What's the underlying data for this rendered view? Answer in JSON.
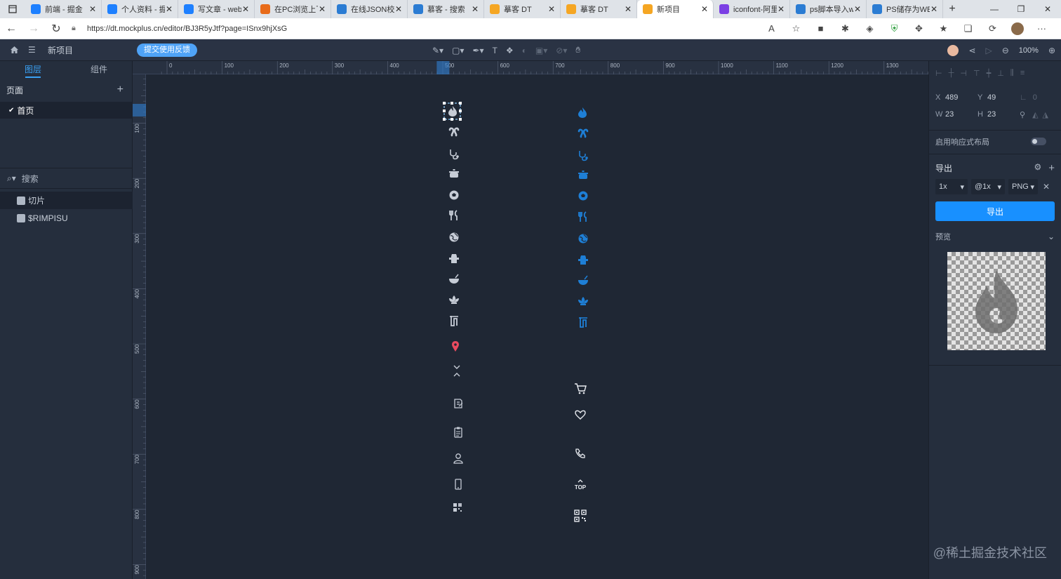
{
  "tabs": [
    {
      "title": "前端 - 掘金",
      "favcolor": "#1e80ff"
    },
    {
      "title": "个人资料 - 掘",
      "favcolor": "#1e80ff"
    },
    {
      "title": "写文章 - web",
      "favcolor": "#1e80ff"
    },
    {
      "title": "在PC浏览上下",
      "favcolor": "#e86b1a"
    },
    {
      "title": "在线JSON校验",
      "favcolor": "#2b7cd3"
    },
    {
      "title": "慕客 - 搜索",
      "favcolor": "#2b7cd3"
    },
    {
      "title": "摹客 DT",
      "favcolor": "#f5a623"
    },
    {
      "title": "摹客 DT",
      "favcolor": "#f5a623"
    },
    {
      "title": "新项目",
      "favcolor": "#f5a623",
      "active": true
    },
    {
      "title": "iconfont-阿里",
      "favcolor": "#7b3fe4"
    },
    {
      "title": "ps脚本导入w",
      "favcolor": "#2b7cd3"
    },
    {
      "title": "PS储存为WEB",
      "favcolor": "#2b7cd3"
    }
  ],
  "url": "https://dt.mockplus.cn/editor/BJ3R5yJtf?page=ISnx9hjXsG",
  "toolbar": {
    "project_name": "新项目",
    "feedback_label": "提交使用反馈",
    "zoom": "100%"
  },
  "left": {
    "tab_layers": "图层",
    "tab_components": "组件",
    "pages_header": "页面",
    "pages": [
      "首页"
    ],
    "search_placeholder": "搜索",
    "layers": [
      "切片",
      "$RIMPISU"
    ]
  },
  "ruler": {
    "h_labels": [
      "0",
      "100",
      "200",
      "300",
      "400",
      "500",
      "600",
      "700",
      "800",
      "900",
      "1000",
      "1100",
      "1200",
      "1300"
    ],
    "v_labels": [
      "100",
      "200",
      "300",
      "400",
      "500",
      "600",
      "700",
      "800",
      "900"
    ]
  },
  "right": {
    "x_label": "X",
    "x_value": "489",
    "y_label": "Y",
    "y_value": "49",
    "w_label": "W",
    "w_value": "23",
    "h_label": "H",
    "h_value": "23",
    "rot_value": "0",
    "responsive_label": "启用响应式布局",
    "export_header": "导出",
    "export_scale": "1x",
    "export_suffix": "@1x",
    "export_format": "PNG",
    "export_button": "导出",
    "preview_label": "预览"
  },
  "canvas": {
    "gray_icons": [
      "fire",
      "kidneys",
      "stethoscope",
      "pot",
      "soccer",
      "fork-knife",
      "globe",
      "fire-hydrant",
      "bowl",
      "lotus",
      "towel",
      "location-pin",
      "chevrons",
      "edit",
      "clipboard",
      "user",
      "phone-device",
      "qr-grid"
    ],
    "blue_icons": [
      "fire",
      "kidneys",
      "stethoscope",
      "pot",
      "soccer",
      "fork-knife",
      "globe",
      "fire-hydrant",
      "bowl",
      "lotus",
      "towel"
    ],
    "right_icons": [
      "cart",
      "heart",
      "phone",
      "top",
      "qrcode"
    ],
    "top_label": "TOP"
  },
  "watermark": "@稀土掘金技术社区"
}
